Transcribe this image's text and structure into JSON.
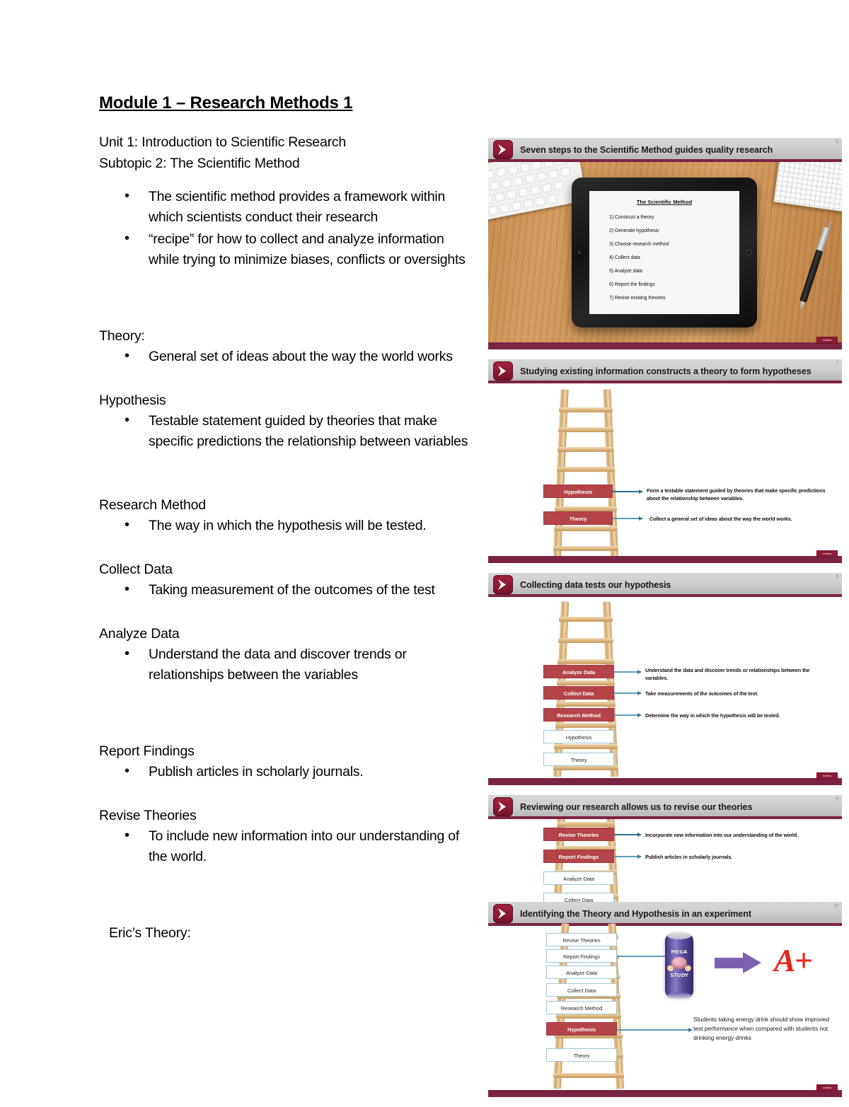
{
  "document": {
    "title": "Module 1 – Research Methods 1",
    "unit": "Unit 1: Introduction to Scientific Research",
    "subtopic": "Subtopic 2: The Scientific Method",
    "intro_bullets": [
      "The scientific method provides a framework within which scientists conduct their research",
      "“recipe” for how to collect and analyze information while trying to minimize biases, conflicts or oversights"
    ],
    "sections": [
      {
        "heading": "Theory:",
        "bullets": [
          "General set of ideas about the way the world works"
        ]
      },
      {
        "heading": "Hypothesis",
        "bullets": [
          "Testable statement guided by theories that make specific predictions the relationship between variables"
        ]
      },
      {
        "heading": "Research Method",
        "bullets": [
          "The way in which the hypothesis will be tested."
        ]
      },
      {
        "heading": "Collect Data",
        "bullets": [
          "Taking measurement of the outcomes of the test"
        ]
      },
      {
        "heading": "Analyze Data",
        "bullets": [
          "Understand the data and discover trends or relationships between the variables"
        ]
      },
      {
        "heading": "Report Findings",
        "bullets": [
          "Publish articles in scholarly journals."
        ]
      },
      {
        "heading": "Revise Theories",
        "bullets": [
          "To include new information into our understanding of the world."
        ]
      }
    ],
    "closing": "Eric’s Theory:"
  },
  "colors": {
    "accent_maroon": "#7b2342",
    "chevron_red": "#8e1b38",
    "step_red": "#b4444a",
    "connector_blue": "#5f9dba",
    "ladder_wood": "#d9b27c",
    "can_purple": "#5b4d9c",
    "arrow_purple": "#7b62b0",
    "grade_red": "#e8251c",
    "header_grey": "#cfcfcf"
  },
  "slides": [
    {
      "number": "6",
      "title": "Seven steps to the Scientific Method guides quality research",
      "icon": "chevron-right-icon",
      "footer_badge": "mmlbox",
      "tablet": {
        "title": "The Scientific Method",
        "steps": [
          "1) Construct a theory",
          "2) Generate hypothesis",
          "3) Choose research method",
          "4) Collect data",
          "5) Analyze data",
          "6) Report the findings",
          "7) Revise existing theories"
        ]
      },
      "photo_objects": [
        "keyboard",
        "notebook",
        "pen",
        "tablet",
        "wooden-desk"
      ]
    },
    {
      "number": "7",
      "title": "Studying existing information constructs a theory to form hypotheses",
      "icon": "chevron-right-icon",
      "footer_badge": "mmlbox",
      "ladder": {
        "steps": [
          {
            "label": "Hypothesis",
            "style": "red",
            "desc": "Form a testable statement guided by theories that make specific predictions about the relationship between variables."
          },
          {
            "label": "Theory",
            "style": "red",
            "desc": "Collect a general set of ideas about the way the world works."
          }
        ]
      }
    },
    {
      "number": "8",
      "title": "Collecting data tests our hypothesis",
      "icon": "chevron-right-icon",
      "footer_badge": "mmlbox",
      "ladder": {
        "steps": [
          {
            "label": "Analyze Data",
            "style": "red",
            "desc": "Understand the data and discover trends or relationships between the variables."
          },
          {
            "label": "Collect Data",
            "style": "red",
            "desc": "Take measurements of the outcomes of the test."
          },
          {
            "label": "Research Method",
            "style": "red",
            "desc": "Determine the way in which the hypothesis will be tested."
          },
          {
            "label": "Hypothesis",
            "style": "white",
            "desc": ""
          },
          {
            "label": "Theory",
            "style": "white",
            "desc": ""
          }
        ]
      }
    },
    {
      "number": "9",
      "title": "Reviewing our research allows us to revise our theories",
      "icon": "chevron-right-icon",
      "footer_badge": "mmlbox",
      "ladder": {
        "steps": [
          {
            "label": "Revise Theories",
            "style": "red",
            "desc": "Incorporate new information into our understanding of the world."
          },
          {
            "label": "Report Findings",
            "style": "red",
            "desc": "Publish articles in scholarly journals."
          },
          {
            "label": "Analyze Data",
            "style": "white",
            "desc": ""
          },
          {
            "label": "Collect Data",
            "style": "white",
            "desc": ""
          }
        ]
      }
    },
    {
      "number": "10",
      "title": "Identifying the Theory and Hypothesis in an experiment",
      "icon": "chevron-right-icon",
      "footer_badge": "mmlbox",
      "ladder": {
        "steps": [
          {
            "label": "Revise Theories",
            "style": "white",
            "desc": ""
          },
          {
            "label": "Report Findings",
            "style": "white",
            "desc": ""
          },
          {
            "label": "Analyze Data",
            "style": "white",
            "desc": ""
          },
          {
            "label": "Collect Data",
            "style": "white",
            "desc": ""
          },
          {
            "label": "Research Method",
            "style": "white",
            "desc": ""
          },
          {
            "label": "Hypothesis",
            "style": "red",
            "desc": ""
          },
          {
            "label": "Theory",
            "style": "white",
            "desc": ""
          }
        ]
      },
      "experiment": {
        "can_top_word": "MEGA",
        "can_bottom_word": "STUDY",
        "grade": "A+",
        "hypothesis_text": "Students taking energy drink should show improved test performance when compared with students not drinking energy drinks"
      }
    }
  ]
}
